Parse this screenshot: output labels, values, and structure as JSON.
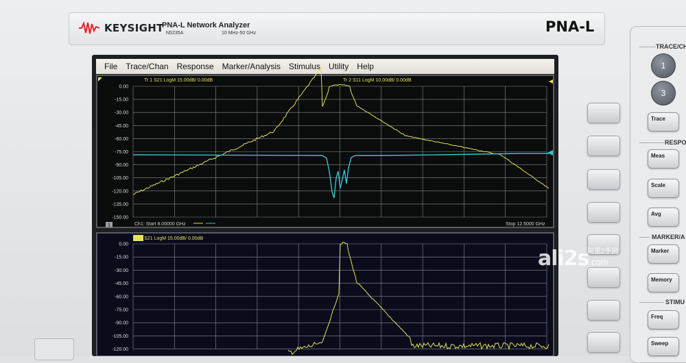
{
  "instrument": {
    "brand": "KEYSIGHT",
    "model_name": "PNA-L Network Analyzer",
    "model_number": "N5235A",
    "freq_range": "10 MHz-50 GHz",
    "badge": "PNA-L"
  },
  "menu": [
    "File",
    "Trace/Chan",
    "Response",
    "Marker/Analysis",
    "Stimulus",
    "Utility",
    "Help"
  ],
  "colors": {
    "trace_yellow": "#e4e15c",
    "trace_cyan": "#39c3cf",
    "grid": "#8a8f94",
    "panel_bg": "#0b0c0c",
    "lower_bg": "#0a0c1c"
  },
  "upper_window": {
    "window_number": "1",
    "tr1_label": "Tr 1  S21 LogM 15.00dB/  0.00dB",
    "tr2_label": "Tr 2  S11 LogM 10.00dB/  0.00dB",
    "start_label": "Ch1:  Start  8.00000 GHz",
    "stop_label": "Stop  12.5000 GHz",
    "y_ticks": [
      "0.00",
      "-15.00",
      "-30.00",
      "-45.00",
      "-60.00",
      "-75.00",
      "-90.00",
      "-105.00",
      "-120.00",
      "-135.00",
      "-150.00"
    ]
  },
  "lower_window": {
    "tr3_label": "Tr 3   S21 LogM 15.00dB/  0.00dB",
    "y_ticks": [
      "0.00",
      "-15.00",
      "-30.00",
      "-45.00",
      "-60.00",
      "-75.00",
      "-90.00",
      "-105.00",
      "-120.00"
    ]
  },
  "side_panel": {
    "trace_group": "TRACE/CH",
    "btn_1": "1",
    "btn_3": "3",
    "trace_btn": "Trace",
    "response_group": "RESPO",
    "meas_btn": "Meas",
    "scale_btn": "Scale",
    "avg_btn": "Avg",
    "marker_group": "MARKER/A",
    "marker_btn": "Marker",
    "memory_btn": "Memory",
    "stimulus_group": "STIMU",
    "freq_btn": "Freq",
    "sweep_btn": "Sweep"
  },
  "watermark": {
    "main": "ali2s",
    "suffix": ".com",
    "cn": "阿里2手网"
  }
}
